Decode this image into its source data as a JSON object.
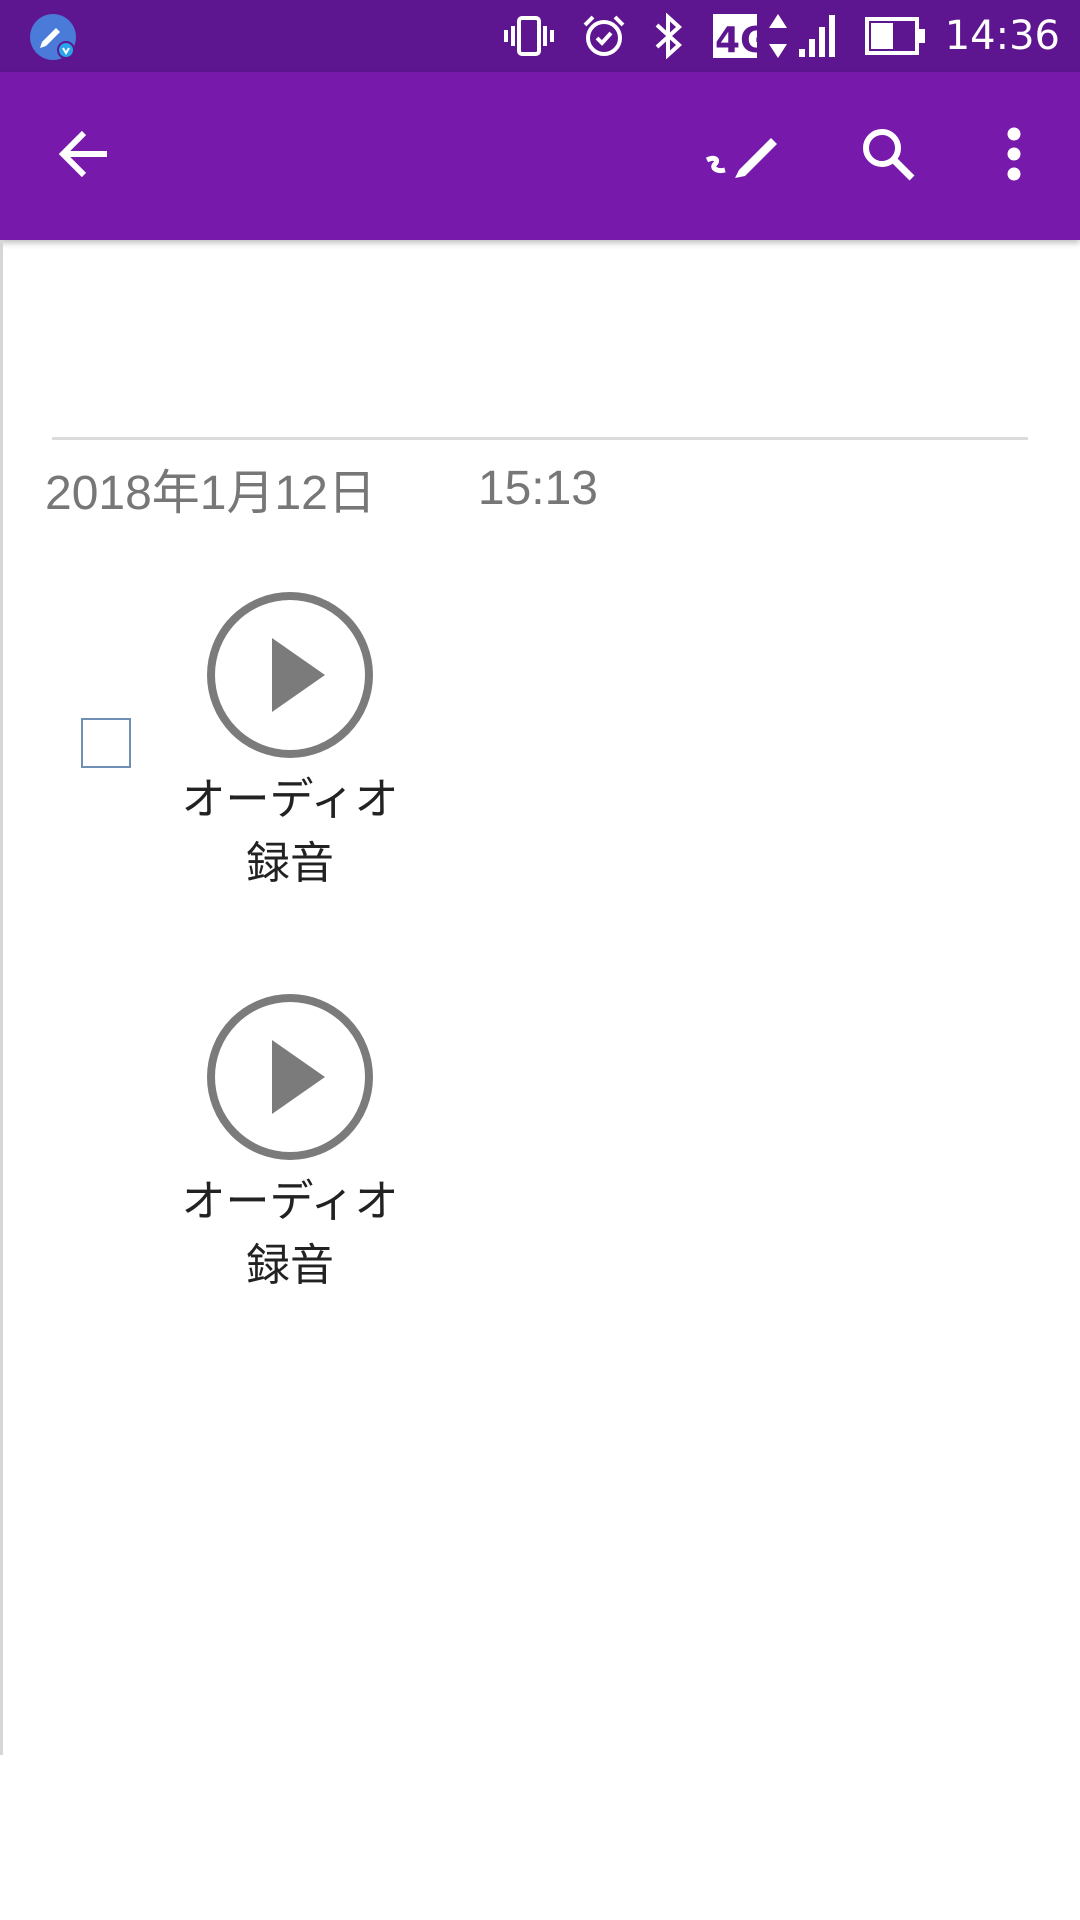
{
  "status_bar": {
    "time": "14:36",
    "network": "4G",
    "icons": [
      "cleaner-app-icon",
      "vibrate-icon",
      "alarm-icon",
      "bluetooth-icon",
      "4g-icon",
      "data-arrows-icon",
      "signal-icon",
      "battery-icon"
    ]
  },
  "app_bar": {
    "icons": [
      "back-arrow-icon",
      "draw-pen-icon",
      "search-icon",
      "more-vert-icon"
    ]
  },
  "note": {
    "date": "2018年1月12日",
    "time": "15:13"
  },
  "attachments": [
    {
      "label_line1": "オーディオ",
      "label_line2": "録音"
    },
    {
      "label_line1": "オーディオ",
      "label_line2": "録音"
    }
  ],
  "colors": {
    "status_bar_bg": "#5e1590",
    "app_bar_bg": "#7719aa",
    "icon_gray": "#7b7b7b",
    "checkbox_border": "#6f8fb4"
  }
}
